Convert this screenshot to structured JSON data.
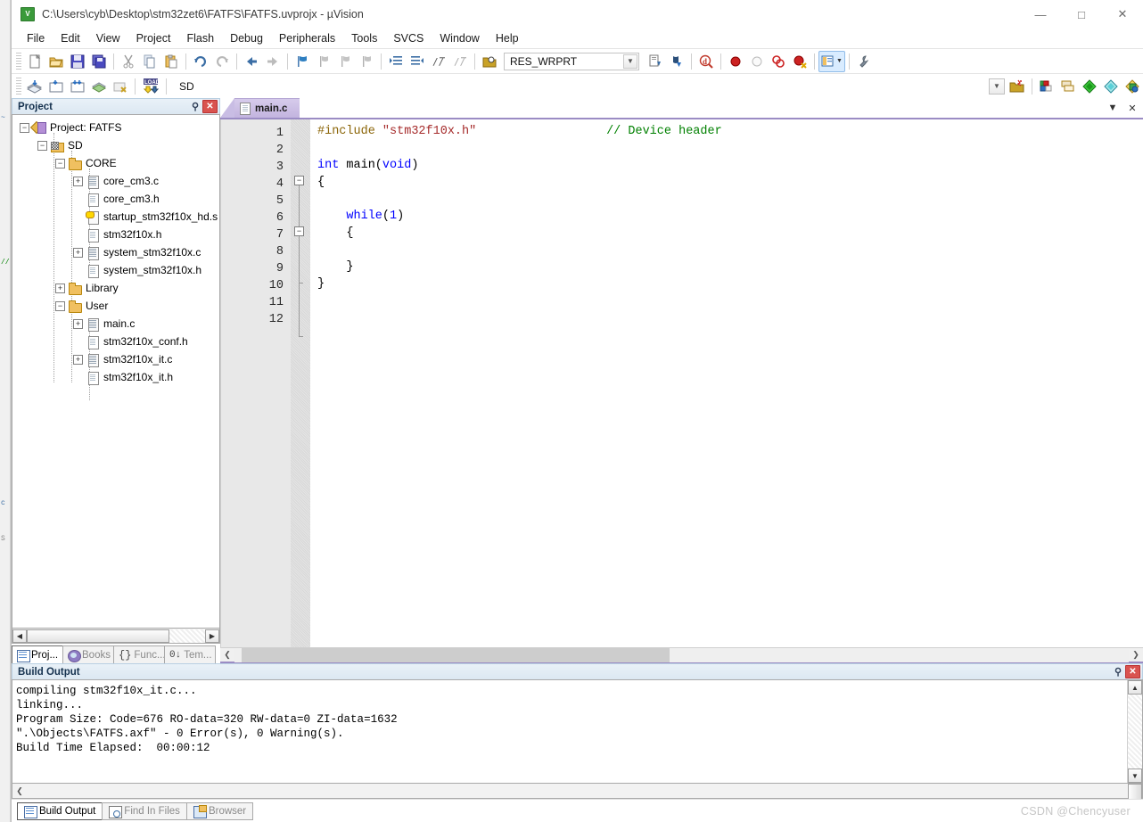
{
  "window": {
    "title": "C:\\Users\\cyb\\Desktop\\stm32zet6\\FATFS\\FATFS.uvprojx - µVision",
    "app_icon": "uvision-icon",
    "minimize": "—",
    "maximize": "□",
    "close": "✕"
  },
  "menu": {
    "items": [
      "File",
      "Edit",
      "View",
      "Project",
      "Flash",
      "Debug",
      "Peripherals",
      "Tools",
      "SVCS",
      "Window",
      "Help"
    ]
  },
  "toolbar_main": {
    "buttons": [
      {
        "name": "new-file-icon"
      },
      {
        "name": "open-file-icon"
      },
      {
        "name": "save-icon"
      },
      {
        "name": "save-all-icon"
      },
      {
        "name": "cut-icon"
      },
      {
        "name": "copy-icon"
      },
      {
        "name": "paste-icon"
      },
      {
        "name": "undo-icon"
      },
      {
        "name": "redo-icon"
      },
      {
        "name": "navigate-back-icon"
      },
      {
        "name": "navigate-forward-icon"
      },
      {
        "name": "bookmark-toggle-icon"
      },
      {
        "name": "bookmark-prev-icon"
      },
      {
        "name": "bookmark-next-icon"
      },
      {
        "name": "bookmark-clear-icon"
      },
      {
        "name": "indent-right-icon"
      },
      {
        "name": "indent-left-icon"
      },
      {
        "name": "comment-icon"
      },
      {
        "name": "uncomment-icon"
      },
      {
        "name": "find-in-files-icon"
      }
    ],
    "combo_value": "RES_WRPRT",
    "after_combo": [
      {
        "name": "insert-bookmark-icon"
      },
      {
        "name": "find-icon"
      },
      {
        "name": "debug-query-icon"
      },
      {
        "name": "breakpoint-insert-icon"
      },
      {
        "name": "breakpoint-disable-icon"
      },
      {
        "name": "breakpoint-kill-all-icon"
      },
      {
        "name": "breakpoint-disable-all-icon"
      },
      {
        "name": "window-manager-icon"
      },
      {
        "name": "configure-icon"
      }
    ]
  },
  "toolbar_build": {
    "buttons": [
      {
        "name": "translate-icon"
      },
      {
        "name": "build-icon"
      },
      {
        "name": "rebuild-icon"
      },
      {
        "name": "batch-build-icon"
      },
      {
        "name": "stop-build-icon"
      },
      {
        "name": "download-icon"
      }
    ],
    "target_value": "SD",
    "right_buttons": [
      {
        "name": "target-options-icon"
      },
      {
        "name": "manage-components-icon"
      },
      {
        "name": "manage-multi-project-icon"
      },
      {
        "name": "pack-installer-icon"
      },
      {
        "name": "manage-runtime-icon"
      }
    ]
  },
  "project_panel": {
    "title": "Project",
    "pin_icon": "pin-icon",
    "close_icon": "close-icon",
    "tree": [
      {
        "label": "Project: FATFS",
        "depth": 0,
        "icon": "project-icon",
        "expander": "-"
      },
      {
        "label": "SD",
        "depth": 1,
        "icon": "target-icon",
        "expander": "-"
      },
      {
        "label": "CORE",
        "depth": 2,
        "icon": "folder-icon",
        "expander": "-"
      },
      {
        "label": "core_cm3.c",
        "depth": 3,
        "icon": "c-file-icon",
        "expander": "+"
      },
      {
        "label": "core_cm3.h",
        "depth": 3,
        "icon": "h-file-icon",
        "expander": ""
      },
      {
        "label": "startup_stm32f10x_hd.s",
        "depth": 3,
        "icon": "asm-file-icon",
        "expander": ""
      },
      {
        "label": "stm32f10x.h",
        "depth": 3,
        "icon": "h-file-icon",
        "expander": ""
      },
      {
        "label": "system_stm32f10x.c",
        "depth": 3,
        "icon": "c-file-icon",
        "expander": "+"
      },
      {
        "label": "system_stm32f10x.h",
        "depth": 3,
        "icon": "h-file-icon",
        "expander": ""
      },
      {
        "label": "Library",
        "depth": 2,
        "icon": "folder-icon",
        "expander": "+"
      },
      {
        "label": "User",
        "depth": 2,
        "icon": "folder-icon",
        "expander": "-"
      },
      {
        "label": "main.c",
        "depth": 3,
        "icon": "c-file-icon",
        "expander": "+"
      },
      {
        "label": "stm32f10x_conf.h",
        "depth": 3,
        "icon": "h-file-icon",
        "expander": ""
      },
      {
        "label": "stm32f10x_it.c",
        "depth": 3,
        "icon": "c-file-icon",
        "expander": "+"
      },
      {
        "label": "stm32f10x_it.h",
        "depth": 3,
        "icon": "h-file-icon",
        "expander": ""
      }
    ],
    "tabs": [
      {
        "label": "Proj...",
        "icon": "project-tab-icon",
        "active": true
      },
      {
        "label": "Books",
        "icon": "books-tab-icon",
        "active": false
      },
      {
        "label": "Func...",
        "icon": "functions-tab-icon",
        "active": false
      },
      {
        "label": "Tem...",
        "icon": "templates-tab-icon",
        "active": false
      }
    ]
  },
  "editor": {
    "tabs": [
      {
        "label": "main.c",
        "active": true
      }
    ],
    "tab_dropdown_icon": "chevron-down-icon",
    "tab_close_icon": "close-icon",
    "line_numbers": [
      "1",
      "2",
      "3",
      "4",
      "5",
      "6",
      "7",
      "8",
      "9",
      "10",
      "11",
      "12"
    ],
    "fold_markers": [
      {
        "line": 4,
        "state": "-"
      },
      {
        "line": 7,
        "state": "-"
      }
    ],
    "lines": [
      {
        "n": 1,
        "tokens": [
          {
            "t": "#include ",
            "c": "pp"
          },
          {
            "t": "\"stm32f10x.h\"",
            "c": "str"
          },
          {
            "t": "                  ",
            "c": "plain"
          },
          {
            "t": "// Device header",
            "c": "cm"
          }
        ]
      },
      {
        "n": 2,
        "tokens": []
      },
      {
        "n": 3,
        "tokens": [
          {
            "t": "int ",
            "c": "k"
          },
          {
            "t": "main(",
            "c": "plain"
          },
          {
            "t": "void",
            "c": "k"
          },
          {
            "t": ")",
            "c": "plain"
          }
        ]
      },
      {
        "n": 4,
        "tokens": [
          {
            "t": "{",
            "c": "plain"
          }
        ]
      },
      {
        "n": 5,
        "tokens": []
      },
      {
        "n": 6,
        "tokens": [
          {
            "t": "    ",
            "c": "plain"
          },
          {
            "t": "while",
            "c": "k"
          },
          {
            "t": "(",
            "c": "plain"
          },
          {
            "t": "1",
            "c": "num"
          },
          {
            "t": ")",
            "c": "plain"
          }
        ]
      },
      {
        "n": 7,
        "tokens": [
          {
            "t": "    {",
            "c": "plain"
          }
        ]
      },
      {
        "n": 8,
        "tokens": []
      },
      {
        "n": 9,
        "tokens": [
          {
            "t": "    }",
            "c": "plain"
          }
        ]
      },
      {
        "n": 10,
        "tokens": [
          {
            "t": "}",
            "c": "plain"
          }
        ]
      },
      {
        "n": 11,
        "tokens": []
      },
      {
        "n": 12,
        "tokens": []
      }
    ]
  },
  "build_output": {
    "title": "Build Output",
    "pin_icon": "pin-icon",
    "close_icon": "close-icon",
    "lines": [
      "compiling stm32f10x_it.c...",
      "linking...",
      "Program Size: Code=676 RO-data=320 RW-data=0 ZI-data=1632",
      "\".\\Objects\\FATFS.axf\" - 0 Error(s), 0 Warning(s).",
      "Build Time Elapsed:  00:00:12"
    ]
  },
  "status_bar": {
    "tabs": [
      {
        "label": "Build Output",
        "icon": "build-output-icon",
        "active": true
      },
      {
        "label": "Find In Files",
        "icon": "find-in-files-icon",
        "active": false
      },
      {
        "label": "Browser",
        "icon": "browser-icon",
        "active": false
      }
    ],
    "watermark": "CSDN @Chencyuser"
  },
  "colors": {
    "accent": "#9b8cc4",
    "keyword": "#0000ff",
    "string": "#a52a2a",
    "comment": "#008000",
    "preproc": "#8b6508",
    "panel_header": "#dce8f2"
  }
}
